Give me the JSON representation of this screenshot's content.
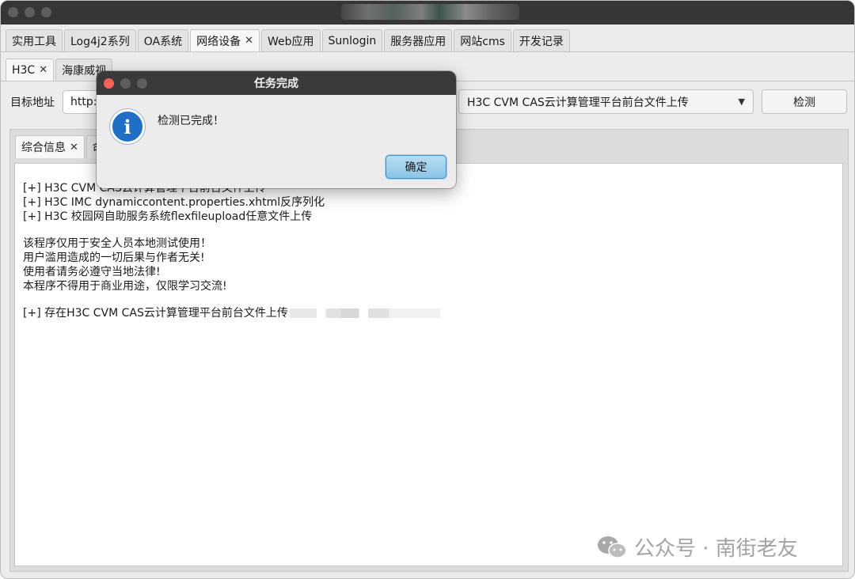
{
  "main_tabs": [
    {
      "label": "实用工具",
      "active": false,
      "closable": false
    },
    {
      "label": "Log4j2系列",
      "active": false,
      "closable": false
    },
    {
      "label": "OA系统",
      "active": false,
      "closable": false
    },
    {
      "label": "网络设备",
      "active": true,
      "closable": true
    },
    {
      "label": "Web应用",
      "active": false,
      "closable": false
    },
    {
      "label": "Sunlogin",
      "active": false,
      "closable": false
    },
    {
      "label": "服务器应用",
      "active": false,
      "closable": false
    },
    {
      "label": "网站cms",
      "active": false,
      "closable": false
    },
    {
      "label": "开发记录",
      "active": false,
      "closable": false
    }
  ],
  "sub_tabs": [
    {
      "label": "H3C",
      "active": true,
      "closable": true
    },
    {
      "label": "海康威视",
      "active": false,
      "closable": false
    }
  ],
  "target": {
    "label": "目标地址",
    "value": "http://"
  },
  "exploit_select": {
    "selected": "H3C CVM CAS云计算管理平台前台文件上传"
  },
  "detect_button": "检测",
  "inner_tabs": [
    {
      "label": "综合信息",
      "active": true,
      "closable": true
    },
    {
      "label": "命",
      "active": false,
      "closable": false
    }
  ],
  "output": {
    "lines": [
      "[+] H3C CVM CAS云计算管理平台前台文件上传",
      "[+] H3C IMC dynamiccontent.properties.xhtml反序列化",
      "[+] H3C 校园网自助服务系统flexfileupload任意文件上传",
      "",
      "该程序仅用于安全人员本地测试使用！",
      "用户滥用造成的一切后果与作者无关!",
      "使用者请务必遵守当地法律!",
      "本程序不得用于商业用途，仅限学习交流!",
      "",
      "[+] 存在H3C CVM CAS云计算管理平台前台文件上传"
    ]
  },
  "dialog": {
    "title": "任务完成",
    "message": "检测已完成！",
    "ok_label": "确定",
    "icon": "info-icon"
  },
  "watermark": {
    "text": "公众号 · 南街老友",
    "icon": "wechat-icon"
  },
  "colors": {
    "titlebar": "#363636",
    "close_red": "#ff5f57",
    "info_blue": "#1f6fc6",
    "ok_button": "#8cc4e8"
  }
}
